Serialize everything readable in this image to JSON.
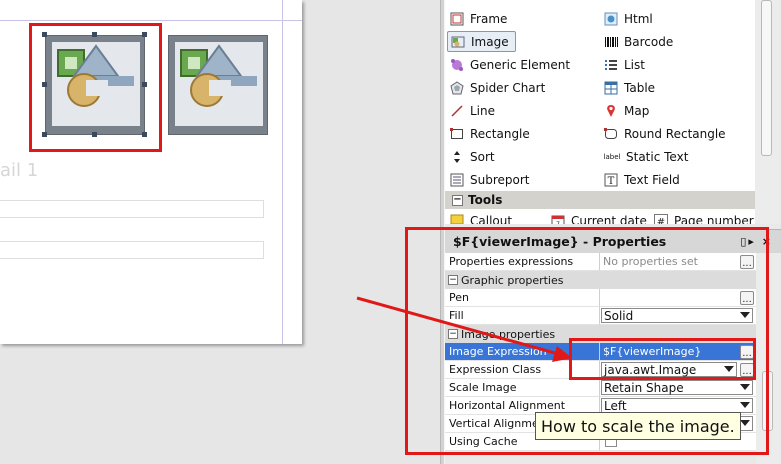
{
  "canvas": {
    "ghost_text": "ail 1"
  },
  "palette": {
    "left_items": [
      {
        "label": "Frame",
        "icon": "frame-icon"
      },
      {
        "label": "Image",
        "icon": "image-icon",
        "selected": true
      },
      {
        "label": "Generic Element",
        "icon": "generic-element-icon"
      },
      {
        "label": "Spider Chart",
        "icon": "spider-chart-icon"
      },
      {
        "label": "Line",
        "icon": "line-icon"
      },
      {
        "label": "Rectangle",
        "icon": "rectangle-icon"
      },
      {
        "label": "Sort",
        "icon": "sort-icon"
      },
      {
        "label": "Subreport",
        "icon": "subreport-icon"
      }
    ],
    "right_items": [
      {
        "label": "Html",
        "icon": "html-icon"
      },
      {
        "label": "Barcode",
        "icon": "barcode-icon"
      },
      {
        "label": "List",
        "icon": "list-icon"
      },
      {
        "label": "Table",
        "icon": "table-icon"
      },
      {
        "label": "Map",
        "icon": "map-icon"
      },
      {
        "label": "Round Rectangle",
        "icon": "round-rectangle-icon"
      },
      {
        "label": "Static Text",
        "icon": "static-text-icon"
      },
      {
        "label": "Text Field",
        "icon": "text-field-icon"
      }
    ],
    "tools_header": "Tools",
    "tools_items": [
      {
        "label": "Callout",
        "icon": "callout-icon"
      },
      {
        "label": "Current date",
        "icon": "calendar-icon"
      },
      {
        "label": "Page number",
        "icon": "hash-icon"
      }
    ],
    "static_text_icon_glyph": "label"
  },
  "properties": {
    "title": "$F{viewerImage} - Properties",
    "title_buttons": "▯▸ ×",
    "rows": {
      "properties_expressions": {
        "key": "Properties expressions",
        "value": "No properties set"
      },
      "graphic_section": "Graphic properties",
      "pen": {
        "key": "Pen",
        "value": ""
      },
      "fill": {
        "key": "Fill",
        "value": "Solid"
      },
      "image_section": "Image properties",
      "image_expression": {
        "key": "Image Expression",
        "value": "$F{viewerImage}"
      },
      "expression_class": {
        "key": "Expression Class",
        "value": "java.awt.Image"
      },
      "scale_image": {
        "key": "Scale Image",
        "value": "Retain Shape"
      },
      "horizontal_alignment": {
        "key": "Horizontal Alignment",
        "value": "Left"
      },
      "vertical_alignment": {
        "key": "Vertical Alignment",
        "value": ""
      },
      "using_cache": {
        "key": "Using Cache",
        "value": ""
      }
    },
    "dots_label": "...",
    "tooltip": "How to scale the image."
  },
  "colors": {
    "annotation_red": "#e01818",
    "selection_blue": "#3875d7",
    "tooltip_bg": "#ffffe1"
  }
}
